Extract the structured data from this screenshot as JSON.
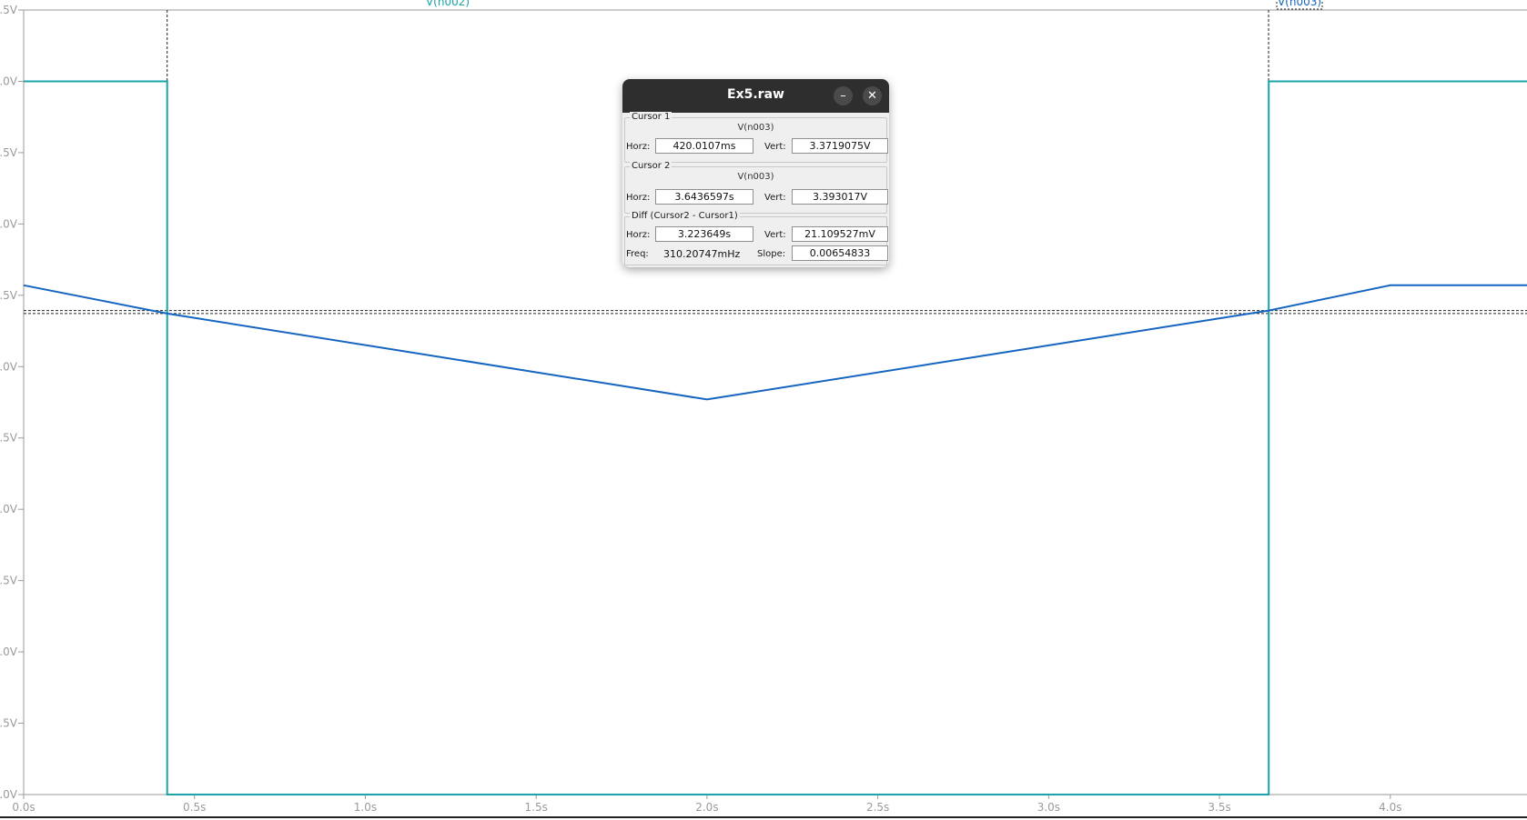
{
  "dialog": {
    "title": "Ex5.raw",
    "minimize_icon": "minimize-icon",
    "close_icon": "close-icon",
    "cursor1": {
      "title": "Cursor 1",
      "node": "V(n003)",
      "horz_label": "Horz:",
      "horz": "420.0107ms",
      "vert_label": "Vert:",
      "vert": "3.3719075V"
    },
    "cursor2": {
      "title": "Cursor 2",
      "node": "V(n003)",
      "horz_label": "Horz:",
      "horz": "3.6436597s",
      "vert_label": "Vert:",
      "vert": "3.393017V"
    },
    "diff": {
      "title": "Diff (Cursor2 - Cursor1)",
      "horz_label": "Horz:",
      "horz": "3.223649s",
      "vert_label": "Vert:",
      "vert": "21.109527mV",
      "freq_label": "Freq:",
      "freq": "310.20747mHz",
      "slope_label": "Slope:",
      "slope": "0.00654833"
    }
  },
  "chart_data": {
    "type": "line",
    "xlim": [
      0,
      4.4
    ],
    "ylim": [
      0,
      5.5
    ],
    "x_ticks": [
      0,
      0.5,
      1,
      1.5,
      2,
      2.5,
      3,
      3.5,
      4
    ],
    "x_tick_labels": [
      "0.0s",
      "0.5s",
      "1.0s",
      "1.5s",
      "2.0s",
      "2.5s",
      "3.0s",
      "3.5s",
      "4.0s"
    ],
    "y_ticks": [
      0,
      0.5,
      1,
      1.5,
      2,
      2.5,
      3,
      3.5,
      4,
      4.5,
      5,
      5.5
    ],
    "y_tick_labels": [
      ".0V",
      ".5V",
      ".0V",
      ".5V",
      ".0V",
      ".5V",
      ".0V",
      ".5V",
      ".0V",
      ".5V",
      ".0V",
      ".5V"
    ],
    "grid": false,
    "series": [
      {
        "name": "V(n002)",
        "color": "#1aa3a8",
        "points": [
          [
            0,
            5.0
          ],
          [
            0.42,
            5.0
          ],
          [
            0.42,
            0.0
          ],
          [
            3.644,
            0.0
          ],
          [
            3.644,
            5.0
          ],
          [
            4.4,
            5.0
          ]
        ]
      },
      {
        "name": "V(n003)",
        "color": "#1565c0",
        "points": [
          [
            0,
            3.57
          ],
          [
            0.42,
            3.372
          ],
          [
            2.0,
            2.77
          ],
          [
            3.644,
            3.393
          ],
          [
            4.0,
            3.57
          ],
          [
            4.4,
            3.57
          ]
        ]
      }
    ],
    "cursors": [
      {
        "x": 0.4200107,
        "y": 3.3719075
      },
      {
        "x": 3.6436597,
        "y": 3.393017
      }
    ]
  }
}
